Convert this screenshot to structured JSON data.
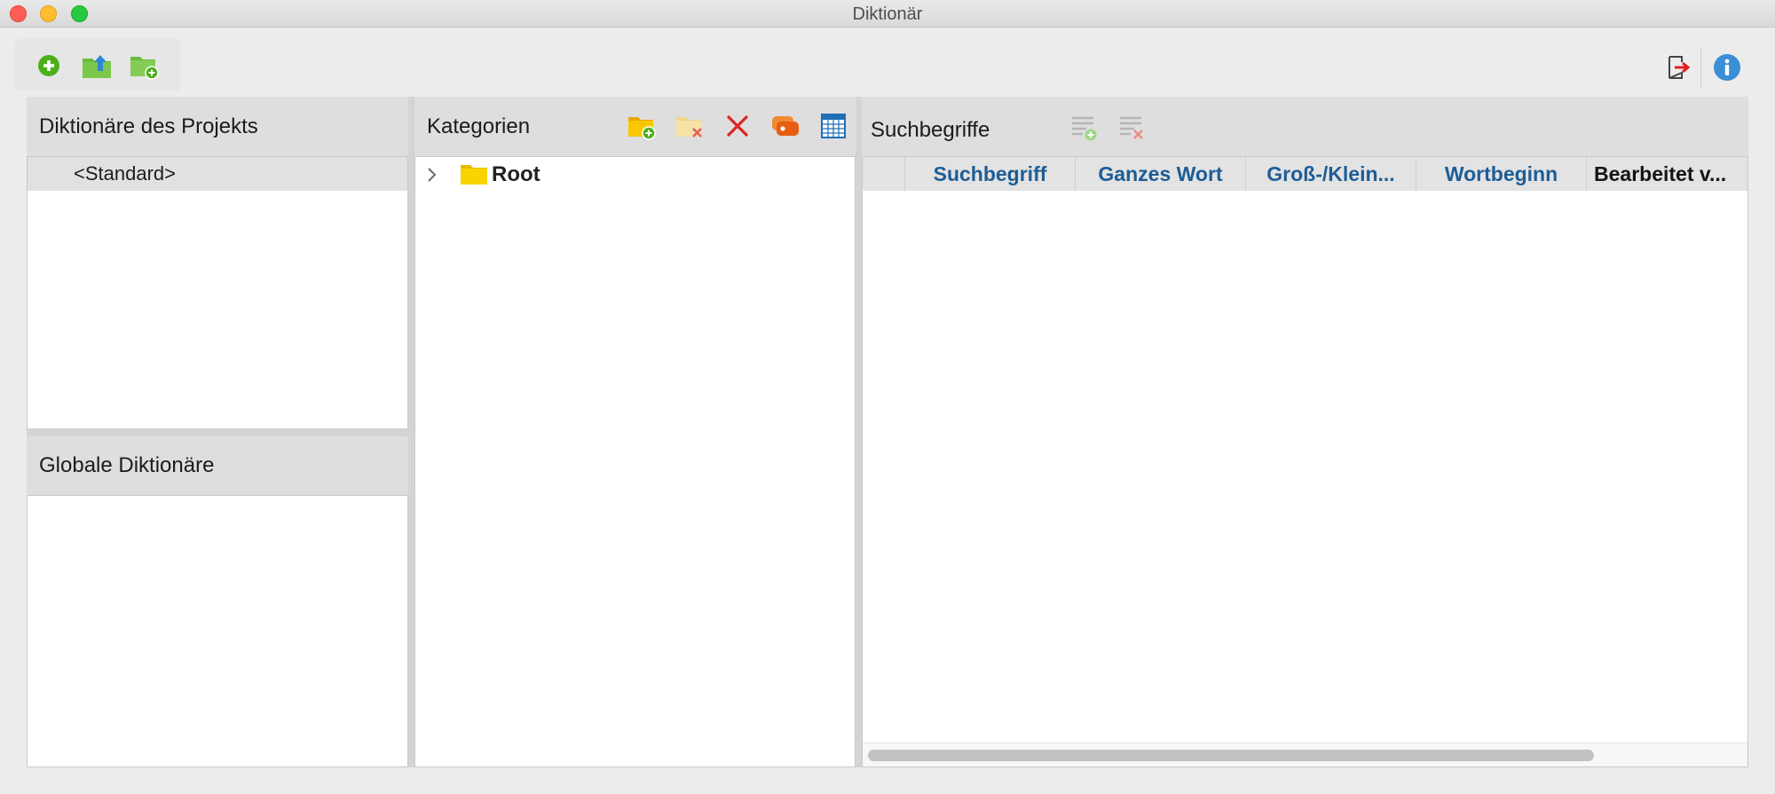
{
  "window": {
    "title": "Diktionär"
  },
  "toolbar": {
    "buttons": [
      {
        "icon": "add-circle-icon",
        "color": "#4caf1a"
      },
      {
        "icon": "folder-upload-icon",
        "color": "#5fb437"
      },
      {
        "icon": "folder-add-icon",
        "color": "#5fb437"
      }
    ],
    "right_buttons": [
      {
        "icon": "exit-icon",
        "color": "#e02020"
      },
      {
        "icon": "info-icon",
        "color": "#3a8fd6"
      }
    ]
  },
  "project_dictionaries": {
    "title": "Diktionäre des Projekts",
    "items": [
      {
        "label": "<Standard>",
        "selected": true
      }
    ]
  },
  "global_dictionaries": {
    "title": "Globale Diktionäre",
    "items": []
  },
  "categories": {
    "title": "Kategorien",
    "tools": [
      {
        "icon": "new-category-folder-icon"
      },
      {
        "icon": "delete-category-folder-icon"
      },
      {
        "icon": "delete-x-icon"
      },
      {
        "icon": "tag-icon"
      },
      {
        "icon": "table-grid-icon"
      }
    ],
    "tree": [
      {
        "label": "Root",
        "expanded": false
      }
    ]
  },
  "search_terms": {
    "title": "Suchbegriffe",
    "tools": [
      {
        "icon": "add-term-icon",
        "enabled": false
      },
      {
        "icon": "delete-term-icon",
        "enabled": false
      }
    ],
    "columns": [
      "Suchbegriff",
      "Ganzes Wort",
      "Groß-/Klein...",
      "Wortbeginn",
      "Bearbeitet v..."
    ],
    "rows": []
  },
  "colors": {
    "accent_column_header": "#1d5d95",
    "folder_yellow": "#f7c800"
  }
}
